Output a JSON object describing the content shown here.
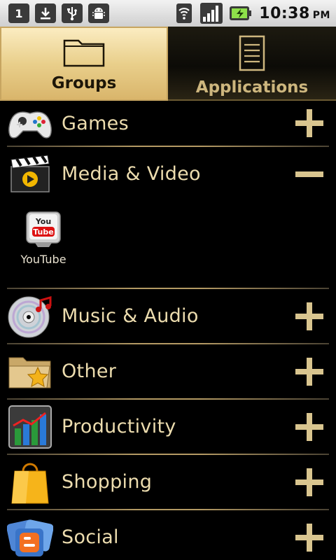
{
  "status_bar": {
    "notif_one": "1",
    "time": "10:38",
    "ampm": "PM",
    "icons": [
      "notification-1-icon",
      "download-icon",
      "usb-icon",
      "android-debug-icon",
      "wifi-icon",
      "signal-icon",
      "battery-charging-icon"
    ]
  },
  "tabs": [
    {
      "label": "Groups",
      "selected": true,
      "icon": "folder-icon"
    },
    {
      "label": "Applications",
      "selected": false,
      "icon": "list-icon"
    }
  ],
  "groups": [
    {
      "label": "Games",
      "icon": "gamepad-icon",
      "state": "collapsed"
    },
    {
      "label": "Media & Video",
      "icon": "clapperboard-icon",
      "state": "expanded",
      "apps": [
        {
          "label": "YouTube",
          "icon": "youtube-icon"
        }
      ]
    },
    {
      "label": "Music & Audio",
      "icon": "cd-music-icon",
      "state": "collapsed"
    },
    {
      "label": "Other",
      "icon": "folder-star-icon",
      "state": "collapsed"
    },
    {
      "label": "Productivity",
      "icon": "bar-chart-icon",
      "state": "collapsed"
    },
    {
      "label": "Shopping",
      "icon": "shopping-bag-icon",
      "state": "collapsed"
    },
    {
      "label": "Social",
      "icon": "blogger-icon",
      "state": "collapsed"
    }
  ],
  "youtube_logo": {
    "top": "You",
    "bottom": "Tube"
  },
  "colors": {
    "accent_gold": "#d9b56b",
    "label_text": "#ecdcae",
    "background": "#000000"
  }
}
